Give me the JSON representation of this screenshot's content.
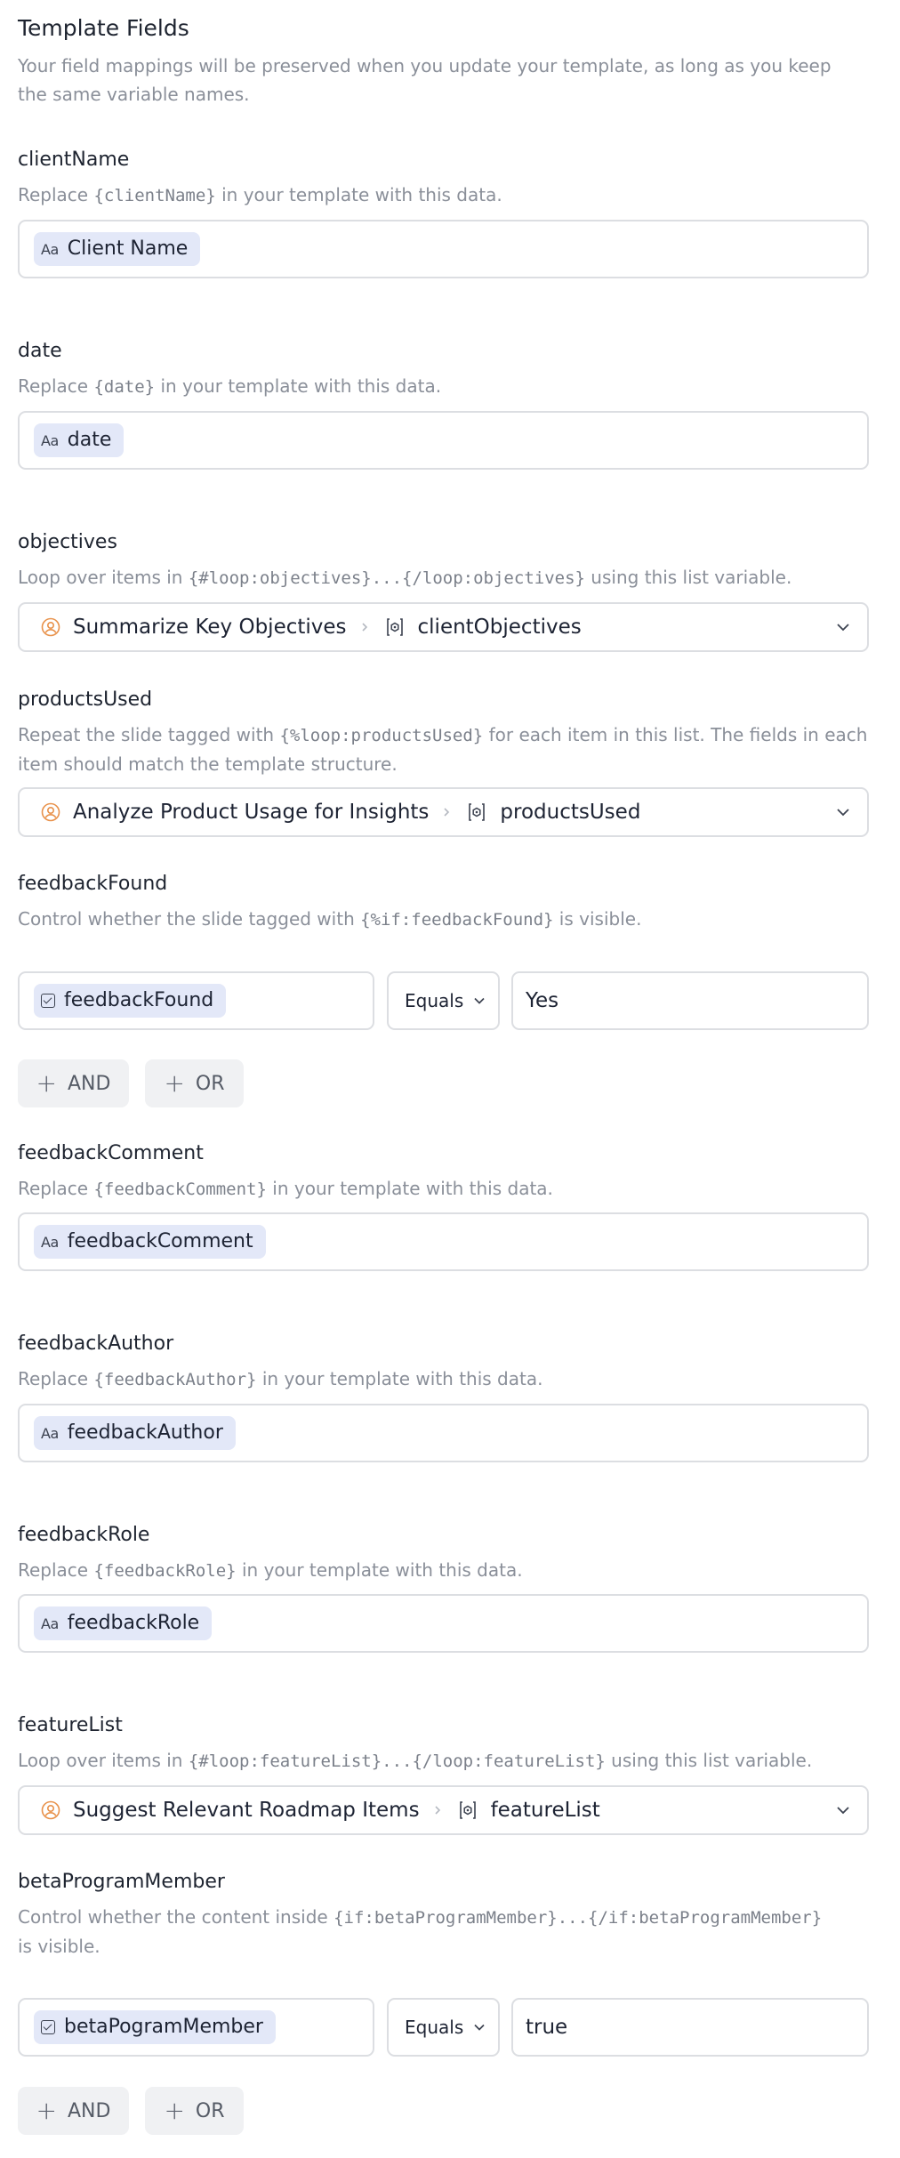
{
  "header": {
    "title": "Template Fields",
    "description": "Your field mappings will be preserved when you update your template, as long as you keep the same variable names."
  },
  "fields": {
    "clientName": {
      "label": "clientName",
      "desc_pre": "Replace ",
      "desc_code": "{clientName}",
      "desc_post": " in your template with this data.",
      "chip_icon": "Aa",
      "chip": "Client Name"
    },
    "date": {
      "label": "date",
      "desc_pre": "Replace ",
      "desc_code": "{date}",
      "desc_post": " in your template with this data.",
      "chip_icon": "Aa",
      "chip": "date"
    },
    "objectives": {
      "label": "objectives",
      "desc_pre": "Loop over items in ",
      "desc_code": "{#loop:objectives}...{/loop:objectives}",
      "desc_post": " using this list variable.",
      "source": "Summarize Key Objectives",
      "variable": "clientObjectives"
    },
    "productsUsed": {
      "label": "productsUsed",
      "desc_pre": "Repeat the slide tagged with ",
      "desc_code": "{%loop:productsUsed}",
      "desc_post": " for each item in this list. The fields in each",
      "desc_line2": "item should match the template structure.",
      "source": "Analyze Product Usage for Insights",
      "variable": "productsUsed"
    },
    "feedbackFound": {
      "label": "feedbackFound",
      "desc_pre": "Control whether the slide tagged with ",
      "desc_code": "{%if:feedbackFound}",
      "desc_post": " is visible.",
      "chip": "feedbackFound",
      "operator": "Equals",
      "value": "Yes",
      "and_label": "AND",
      "or_label": "OR"
    },
    "feedbackComment": {
      "label": "feedbackComment",
      "desc_pre": "Replace ",
      "desc_code": "{feedbackComment}",
      "desc_post": " in your template with this data.",
      "chip_icon": "Aa",
      "chip": "feedbackComment"
    },
    "feedbackAuthor": {
      "label": "feedbackAuthor",
      "desc_pre": "Replace ",
      "desc_code": "{feedbackAuthor}",
      "desc_post": " in your template with this data.",
      "chip_icon": "Aa",
      "chip": "feedbackAuthor"
    },
    "feedbackRole": {
      "label": "feedbackRole",
      "desc_pre": "Replace ",
      "desc_code": "{feedbackRole}",
      "desc_post": " in your template with this data.",
      "chip_icon": "Aa",
      "chip": "feedbackRole"
    },
    "featureList": {
      "label": "featureList",
      "desc_pre": "Loop over items in ",
      "desc_code": "{#loop:featureList}...{/loop:featureList}",
      "desc_post": " using this list variable.",
      "source": "Suggest Relevant Roadmap Items",
      "variable": "featureList"
    },
    "betaProgramMember": {
      "label": "betaProgramMember",
      "desc_pre": "Control whether the content inside ",
      "desc_code": "{if:betaProgramMember}...{/if:betaProgramMember}",
      "desc_line2": "is visible.",
      "chip": "betaPogramMember",
      "operator": "Equals",
      "value": "true",
      "and_label": "AND",
      "or_label": "OR"
    }
  },
  "colors": {
    "chip_bg": "#e3e8f8",
    "accent_orange": "#e8914a",
    "border": "#dcdee2",
    "button_bg": "#f0f1f3",
    "muted_text": "#8a8f99"
  },
  "icons": {
    "text_field": "Aa",
    "checkbox": "checkbox-icon",
    "agent": "person-circle-icon",
    "list": "list-variable-icon",
    "separator": "chevron-right-icon",
    "dropdown": "chevron-down-icon",
    "add": "+"
  }
}
